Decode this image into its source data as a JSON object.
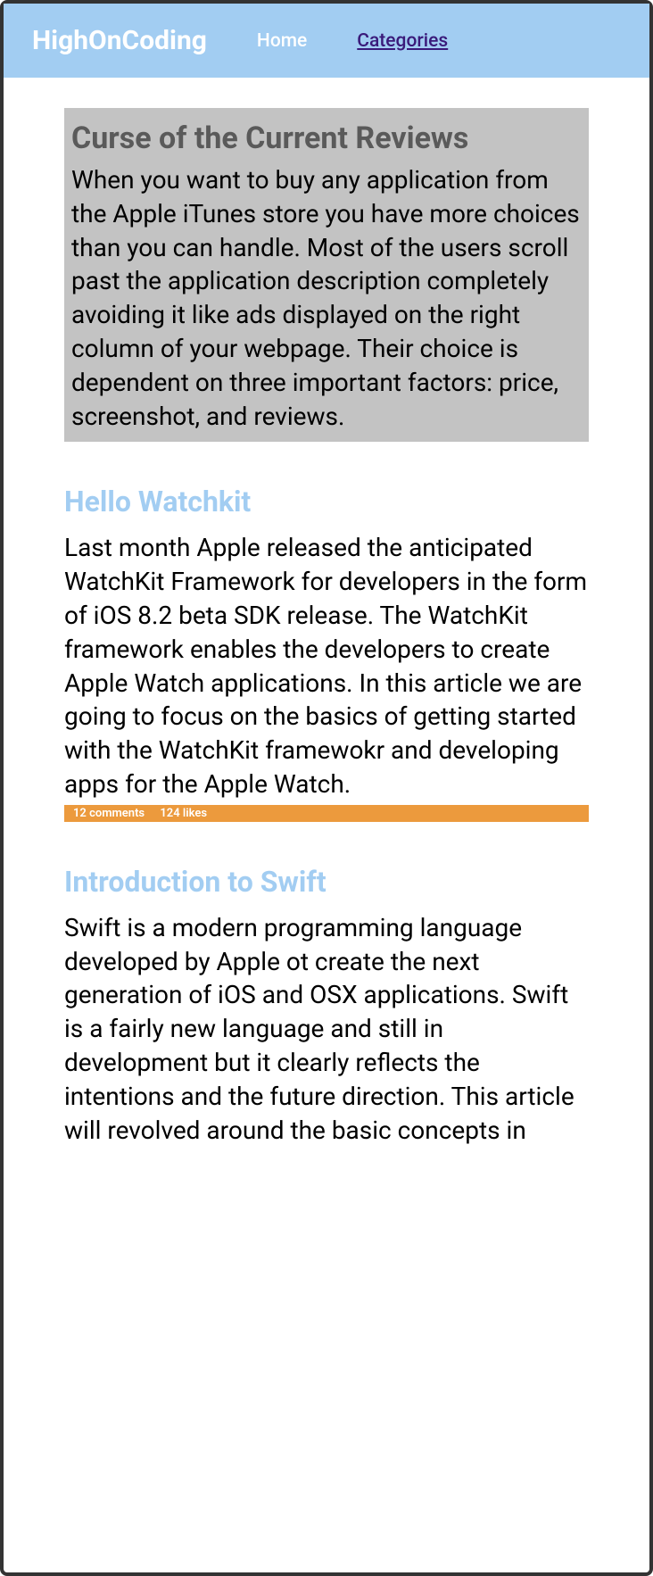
{
  "header": {
    "logo": "HighOnCoding",
    "nav_home": "Home",
    "nav_categories": "Categories"
  },
  "featured": {
    "title": "Curse of the Current Reviews",
    "body": "When you want to buy any application from the Apple iTunes store you have more choices than you can handle. Most of the users scroll past the application description completely avoiding it like ads displayed on the right column of your webpage. Their choice is dependent on three important factors: price, screenshot, and reviews."
  },
  "posts": [
    {
      "title": "Hello Watchkit",
      "body": "Last month Apple released the anticipated WatchKit Framework for developers in the form of iOS 8.2 beta SDK release. The WatchKit framework enables the developers to create Apple Watch applications. In this article we are going to focus on the basics of getting started with the WatchKit framewokr and developing apps for the Apple Watch.",
      "comments": "12 comments",
      "likes": "124 likes"
    },
    {
      "title": "Introduction to Swift",
      "body": "Swift is a modern programming language developed by Apple ot create the next generation of iOS and OSX applications. Swift is a fairly new language and still in development but it clearly reflects the intentions and the future direction. This article will revolved around the basic concepts in",
      "comments": "",
      "likes": ""
    }
  ]
}
